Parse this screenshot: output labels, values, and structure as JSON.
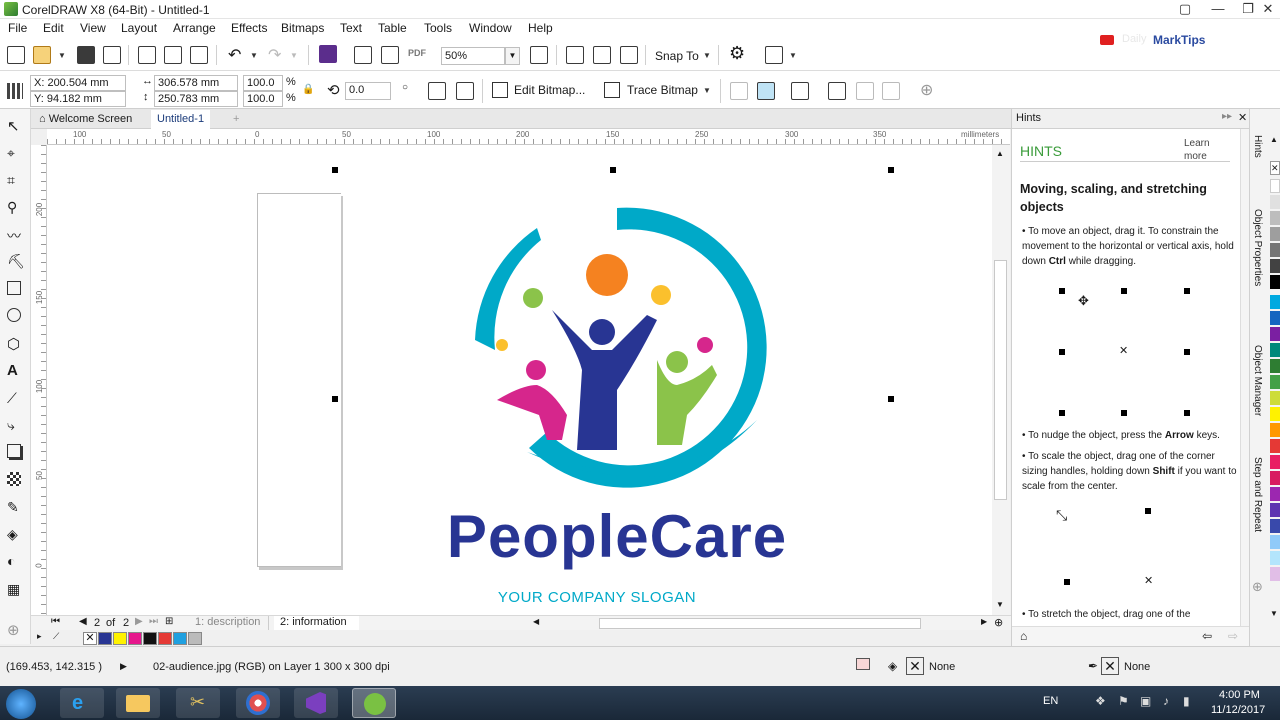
{
  "window": {
    "title": "CorelDRAW X8 (64-Bit) - Untitled-1"
  },
  "menu": [
    "File",
    "Edit",
    "View",
    "Layout",
    "Arrange",
    "Effects",
    "Bitmaps",
    "Text",
    "Table",
    "Tools",
    "Window",
    "Help"
  ],
  "toolbar": {
    "zoom": "50%",
    "snap_to": "Snap To",
    "watermark_a": "Daily",
    "watermark_b": "MarkTips"
  },
  "propbar": {
    "x": "X: 200.504 mm",
    "y": "Y: 94.182 mm",
    "width": "306.578 mm",
    "height": "250.783 mm",
    "scale_w": "100.0",
    "scale_h": "100.0",
    "pct": "%",
    "rotation": "0.0",
    "edit_bitmap": "Edit Bitmap...",
    "trace_bitmap": "Trace Bitmap"
  },
  "tabs": {
    "welcome": "Welcome Screen",
    "doc": "Untitled-1"
  },
  "ruler": {
    "h": [
      "100",
      "50",
      "0",
      "50",
      "100",
      "150",
      "200",
      "250",
      "300",
      "350"
    ],
    "units": "millimeters",
    "v": [
      "200",
      "150",
      "100",
      "50",
      "0"
    ]
  },
  "logo": {
    "brand": "PeopleCare",
    "slogan": "YOUR COMPANY SLOGAN"
  },
  "pagenav": {
    "counter": "2",
    "of": "of",
    "total": "2",
    "page1": "1: description",
    "page2": "2: information"
  },
  "hints": {
    "panel_title": "Hints",
    "heading": "HINTS",
    "learn_more": "Learn more",
    "topic": "Moving, scaling, and stretching objects",
    "tip1": "To move an object, drag it. To constrain the movement to the horizontal or vertical axis, hold down",
    "tip1_key": "Ctrl",
    "tip1_end": "while dragging.",
    "tip2": "To nudge the object, press the",
    "tip2_key": "Arrow",
    "tip2_end": "keys.",
    "tip3": "To scale the object, drag one of the corner sizing handles, holding down",
    "tip3_key": "Shift",
    "tip3_end": "if you want to scale from the center.",
    "tip4": "To stretch the object, drag one of the"
  },
  "dock_tabs": [
    "Hints",
    "Object Properties",
    "Object Manager",
    "Step and Repeat"
  ],
  "status": {
    "coords": "(169.453, 142.315 )",
    "info": "02-audience.jpg (RGB) on Layer 1 300 x 300 dpi",
    "fill": "None",
    "outline": "None"
  },
  "taskbar": {
    "lang": "EN",
    "time": "4:00 PM",
    "date": "11/12/2017"
  },
  "colors": {
    "brand_blue": "#283593",
    "teal": "#00a9c8",
    "orange": "#f58220",
    "green": "#8bc34a",
    "magenta": "#d6268c",
    "yellow": "#fbc02d",
    "hints_green": "#3a9b3a"
  }
}
